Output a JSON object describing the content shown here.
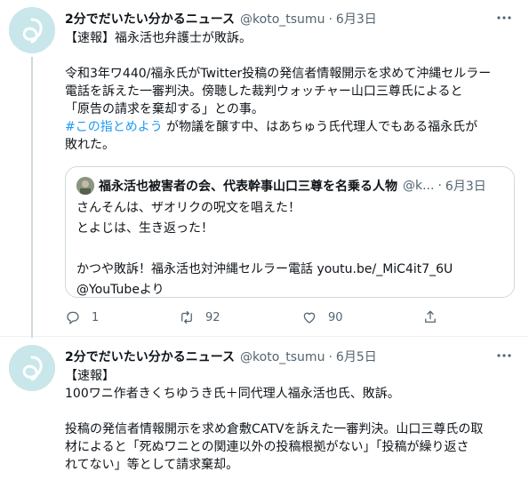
{
  "tweets": [
    {
      "author_name": "2分でだいたい分かるニュース",
      "handle": "@koto_tsumu",
      "separator": "·",
      "date": "6月3日",
      "lines": [
        "【速報】福永活也弁護士が敗訴。",
        "",
        "令和3年ワ440/福永氏がTwitter投稿の発信者情報開示を求めて沖縄セルラー",
        "電話を訴えた一審判決。傍聴した裁判ウォッチャー山口三尊氏によると",
        "「原告の請求を棄却する」との事。"
      ],
      "hashtag": "#この指とめよう",
      "hashtag_rest": " が物議を醸す中、はあちゅう氏代理人でもある福永氏が",
      "last_line": "敗れた。",
      "quote": {
        "author_name": "福永活也被害者の会、代表幹事山口三尊を名乗る人物",
        "handle_trunc": "@k...",
        "separator": "·",
        "date": "6月3日",
        "lines": [
          "さんそんは、ザオリクの呪文を唱えた！",
          "とよじは、生き返った！",
          "",
          "かつや敗訴！福永活也対沖縄セルラー電話 youtu.be/_MiC4it7_6U",
          "@YouTubeより"
        ]
      },
      "actions": {
        "reply_count": "1",
        "retweet_count": "92",
        "like_count": "90"
      }
    },
    {
      "author_name": "2分でだいたい分かるニュース",
      "handle": "@koto_tsumu",
      "separator": "·",
      "date": "6月5日",
      "lines": [
        "【速報】",
        "100ワニ作者きくちゆうき氏＋同代理人福永活也氏、敗訴。",
        "",
        "投稿の発信者情報開示を求め倉敷CATVを訴えた一審判決。山口三尊氏の取",
        "材によると「死ぬワニとの関連以外の投稿根拠がない」「投稿が繰り返さ",
        "れてない」等として請求棄却。"
      ]
    }
  ],
  "icons": {
    "more": "more-icon",
    "reply": "reply-icon",
    "retweet": "retweet-icon",
    "like": "heart-icon",
    "share": "share-icon"
  },
  "colors": {
    "link": "#1d9bf0",
    "secondary_text": "#536471",
    "avatar_bg": "#c9e7ea"
  }
}
